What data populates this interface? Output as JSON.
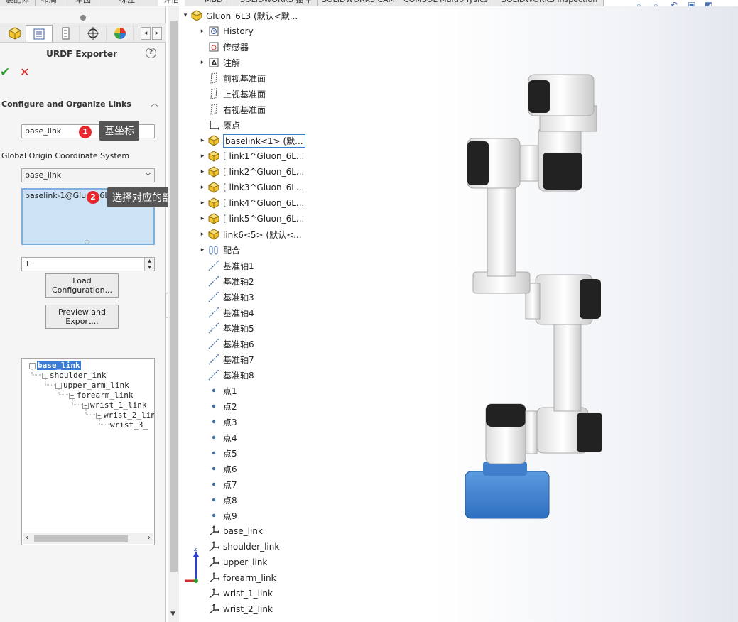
{
  "tabs": [
    "装配体",
    "布局",
    "草图",
    "标注",
    "评估",
    "MBD",
    "SOLIDWORKS 插件",
    "SOLIDWORKS CAM",
    "COMSOL Multiphysics",
    "SOLIDWORKS Inspection"
  ],
  "active_tab_index": 4,
  "manager_tabs": [
    {
      "name": "feature-manager",
      "icon": "part-icon"
    },
    {
      "name": "property-manager",
      "icon": "list-icon"
    },
    {
      "name": "configuration-manager",
      "icon": "config-icon"
    },
    {
      "name": "dimxpert-manager",
      "icon": "crosshair-icon"
    },
    {
      "name": "display-manager",
      "icon": "color-wheel-icon"
    }
  ],
  "property_manager": {
    "title": "URDF Exporter",
    "section_title": "Configure and Organize Links",
    "link_name_value": "base_link",
    "origin_caption": "Global Origin Coordinate System",
    "origin_select_value": "base_link",
    "components_list": "baselink-1@Gluon_6L3",
    "child_count_value": "1",
    "load_button": "Load Configuration...",
    "load_button_lines": [
      "Load",
      "Configuration..."
    ],
    "export_button": "Preview and Export...",
    "export_button_lines": [
      "Preview and",
      "Export..."
    ]
  },
  "annotations": [
    {
      "number": "1",
      "text": "基坐标"
    },
    {
      "number": "2",
      "text": "选择对应的部件"
    }
  ],
  "link_tree": {
    "nodes": [
      {
        "label": "base_link",
        "selected": true
      },
      {
        "label": "shoulder_ink"
      },
      {
        "label": "upper_arm_link"
      },
      {
        "label": "forearm_link"
      },
      {
        "label": "wrist_1_link"
      },
      {
        "label": "wrist_2_lin"
      },
      {
        "label": "wrist_3_"
      }
    ]
  },
  "feature_tree": [
    {
      "label": "Gluon_6L3  (默认<默...",
      "icon": "assembly-icon",
      "expand": "down"
    },
    {
      "label": "History",
      "icon": "history-icon",
      "expand": "right"
    },
    {
      "label": "传感器",
      "icon": "sensor-icon",
      "expand": ""
    },
    {
      "label": "注解",
      "icon": "annotation-icon",
      "expand": "right"
    },
    {
      "label": "前视基准面",
      "icon": "plane-icon",
      "expand": ""
    },
    {
      "label": "上视基准面",
      "icon": "plane-icon",
      "expand": ""
    },
    {
      "label": "右视基准面",
      "icon": "plane-icon",
      "expand": ""
    },
    {
      "label": "原点",
      "icon": "origin-icon",
      "expand": ""
    },
    {
      "label": "baselink<1> (默...",
      "icon": "part-icon",
      "expand": "right",
      "selected": true
    },
    {
      "label": "[ link1^Gluon_6L...",
      "icon": "part-icon",
      "expand": "right"
    },
    {
      "label": "[ link2^Gluon_6L...",
      "icon": "part-icon",
      "expand": "right"
    },
    {
      "label": "[ link3^Gluon_6L...",
      "icon": "part-icon",
      "expand": "right"
    },
    {
      "label": "[ link4^Gluon_6L...",
      "icon": "part-icon",
      "expand": "right"
    },
    {
      "label": "[ link5^Gluon_6L...",
      "icon": "part-icon",
      "expand": "right"
    },
    {
      "label": "link6<5> (默认<...",
      "icon": "part-icon",
      "expand": "right"
    },
    {
      "label": "配合",
      "icon": "mate-icon",
      "expand": "right"
    },
    {
      "label": "基准轴1",
      "icon": "axis-icon",
      "expand": ""
    },
    {
      "label": "基准轴2",
      "icon": "axis-icon",
      "expand": ""
    },
    {
      "label": "基准轴3",
      "icon": "axis-icon",
      "expand": ""
    },
    {
      "label": "基准轴4",
      "icon": "axis-icon",
      "expand": ""
    },
    {
      "label": "基准轴5",
      "icon": "axis-icon",
      "expand": ""
    },
    {
      "label": "基准轴6",
      "icon": "axis-icon",
      "expand": ""
    },
    {
      "label": "基准轴7",
      "icon": "axis-icon",
      "expand": ""
    },
    {
      "label": "基准轴8",
      "icon": "axis-icon",
      "expand": ""
    },
    {
      "label": "点1",
      "icon": "point-icon",
      "expand": ""
    },
    {
      "label": "点2",
      "icon": "point-icon",
      "expand": ""
    },
    {
      "label": "点3",
      "icon": "point-icon",
      "expand": ""
    },
    {
      "label": "点4",
      "icon": "point-icon",
      "expand": ""
    },
    {
      "label": "点5",
      "icon": "point-icon",
      "expand": ""
    },
    {
      "label": "点6",
      "icon": "point-icon",
      "expand": ""
    },
    {
      "label": "点7",
      "icon": "point-icon",
      "expand": ""
    },
    {
      "label": "点8",
      "icon": "point-icon",
      "expand": ""
    },
    {
      "label": "点9",
      "icon": "point-icon",
      "expand": ""
    },
    {
      "label": "base_link",
      "icon": "coordinate-system-icon",
      "expand": ""
    },
    {
      "label": "shoulder_link",
      "icon": "coordinate-system-icon",
      "expand": ""
    },
    {
      "label": "upper_link",
      "icon": "coordinate-system-icon",
      "expand": ""
    },
    {
      "label": "forearm_link",
      "icon": "coordinate-system-icon",
      "expand": ""
    },
    {
      "label": "wrist_1_link",
      "icon": "coordinate-system-icon",
      "expand": ""
    },
    {
      "label": "wrist_2_link",
      "icon": "coordinate-system-icon",
      "expand": ""
    }
  ],
  "axis_triad": {
    "z_label": "z"
  },
  "colors": {
    "accent": "#3a7bd5",
    "ok": "#2a9d2a",
    "cancel": "#dd2222",
    "badge": "#e8262d",
    "robot_base": "#3d7fd0"
  }
}
